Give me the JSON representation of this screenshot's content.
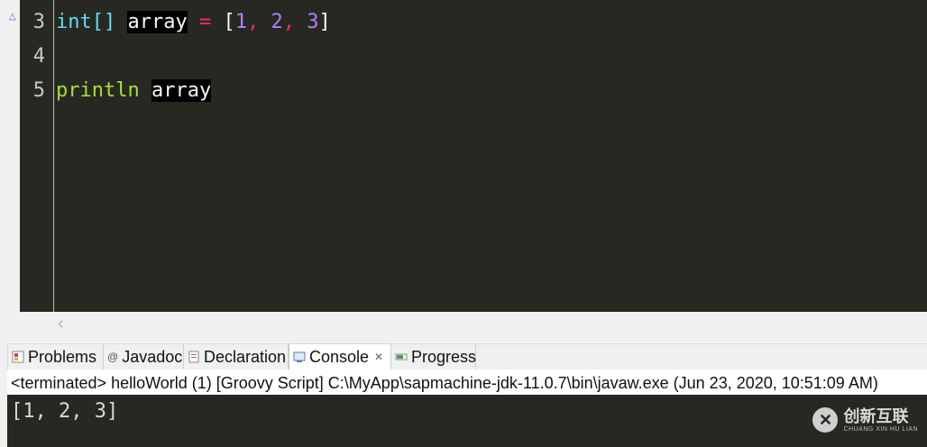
{
  "editor": {
    "lines": [
      {
        "number": "3",
        "tokens": [
          "int[]",
          "array",
          "=",
          "[",
          "1",
          ",",
          "2",
          ",",
          "3",
          "]"
        ]
      },
      {
        "number": "4",
        "tokens": []
      },
      {
        "number": "5",
        "tokens": [
          "println",
          "array"
        ]
      }
    ]
  },
  "tabs": [
    {
      "label": "Problems",
      "icon": "problems-icon"
    },
    {
      "label": "Javadoc",
      "icon": "javadoc-icon"
    },
    {
      "label": "Declaration",
      "icon": "declaration-icon"
    },
    {
      "label": "Console",
      "icon": "console-icon",
      "active": true
    },
    {
      "label": "Progress",
      "icon": "progress-icon"
    }
  ],
  "console": {
    "status": "<terminated> helloWorld (1) [Groovy Script] C:\\MyApp\\sapmachine-jdk-11.0.7\\bin\\javaw.exe (Jun 23, 2020, 10:51:09 AM)",
    "output": "[1, 2, 3]"
  },
  "watermark": {
    "main": "创新互联",
    "sub": "CHUANG XIN HU LIAN"
  },
  "colors": {
    "editor_bg": "#272822",
    "keyword_type": "#66d9ef",
    "operator": "#f92672",
    "number": "#ae81ff",
    "function": "#a6e22e"
  }
}
